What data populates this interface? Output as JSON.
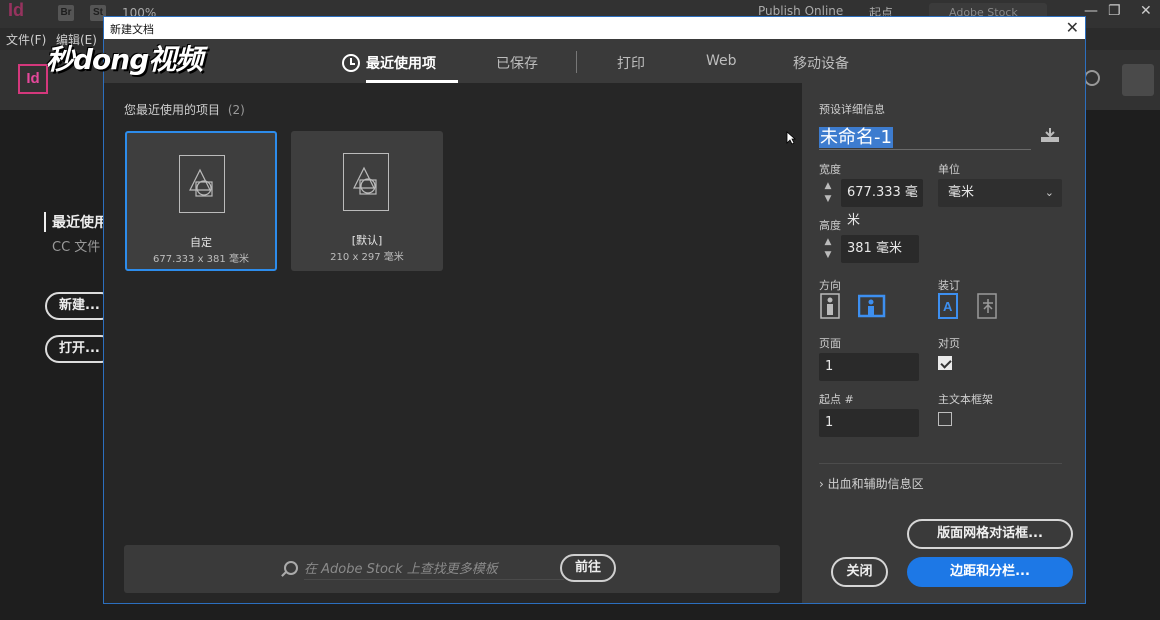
{
  "app": {
    "logo_small": "Id",
    "bridge_chip": "Br",
    "stock_chip": "St",
    "zoom": "100%",
    "publish": "Publish Online",
    "start_workspace": "起点",
    "stock_search_placeholder": "Adobe Stock",
    "menu": [
      "文件(F)",
      "编辑(E)"
    ],
    "logo_big": "Id",
    "side_heading": "最近使用",
    "side_sub": "CC 文件",
    "new_button": "新建...",
    "open_button": "打开..."
  },
  "watermark": "秒dong视频",
  "dialog": {
    "title": "新建文档",
    "close_glyph": "✕",
    "tabs": [
      {
        "label": "最近使用项",
        "active": true
      },
      {
        "label": "已保存",
        "active": false
      },
      {
        "label": "打印",
        "active": false
      },
      {
        "label": "Web",
        "active": false
      },
      {
        "label": "移动设备",
        "active": false
      }
    ],
    "recent": {
      "heading": "您最近使用的项目",
      "count": "(2)",
      "items": [
        {
          "name": "自定",
          "size": "677.333 x 381 毫米",
          "selected": true
        },
        {
          "name": "[默认]",
          "size": "210 x 297 毫米",
          "selected": false
        }
      ]
    },
    "stock": {
      "placeholder": "在 Adobe Stock 上查找更多模板",
      "go_label": "前往"
    },
    "preset": {
      "heading": "预设详细信息",
      "name": "未命名-1",
      "width_label": "宽度",
      "width_value": "677.333 毫米",
      "unit_label": "单位",
      "unit_value": "毫米",
      "height_label": "高度",
      "height_value": "381 毫米",
      "orientation_label": "方向",
      "orientation_selected": "landscape",
      "binding_label": "装订",
      "binding_selected": "left-to-right",
      "pages_label": "页面",
      "pages_value": "1",
      "facing_label": "对页",
      "facing_checked": true,
      "start_label": "起点 #",
      "start_value": "1",
      "primary_frame_label": "主文本框架",
      "primary_frame_checked": false,
      "bleed_label": "出血和辅助信息区",
      "layout_grid_button": "版面网格对话框...",
      "close_button": "关闭",
      "margins_button": "边距和分栏..."
    }
  },
  "colors": {
    "accent": "#1d78e6",
    "selection": "#2d8ceb",
    "indesign_pink": "#d4387c"
  }
}
